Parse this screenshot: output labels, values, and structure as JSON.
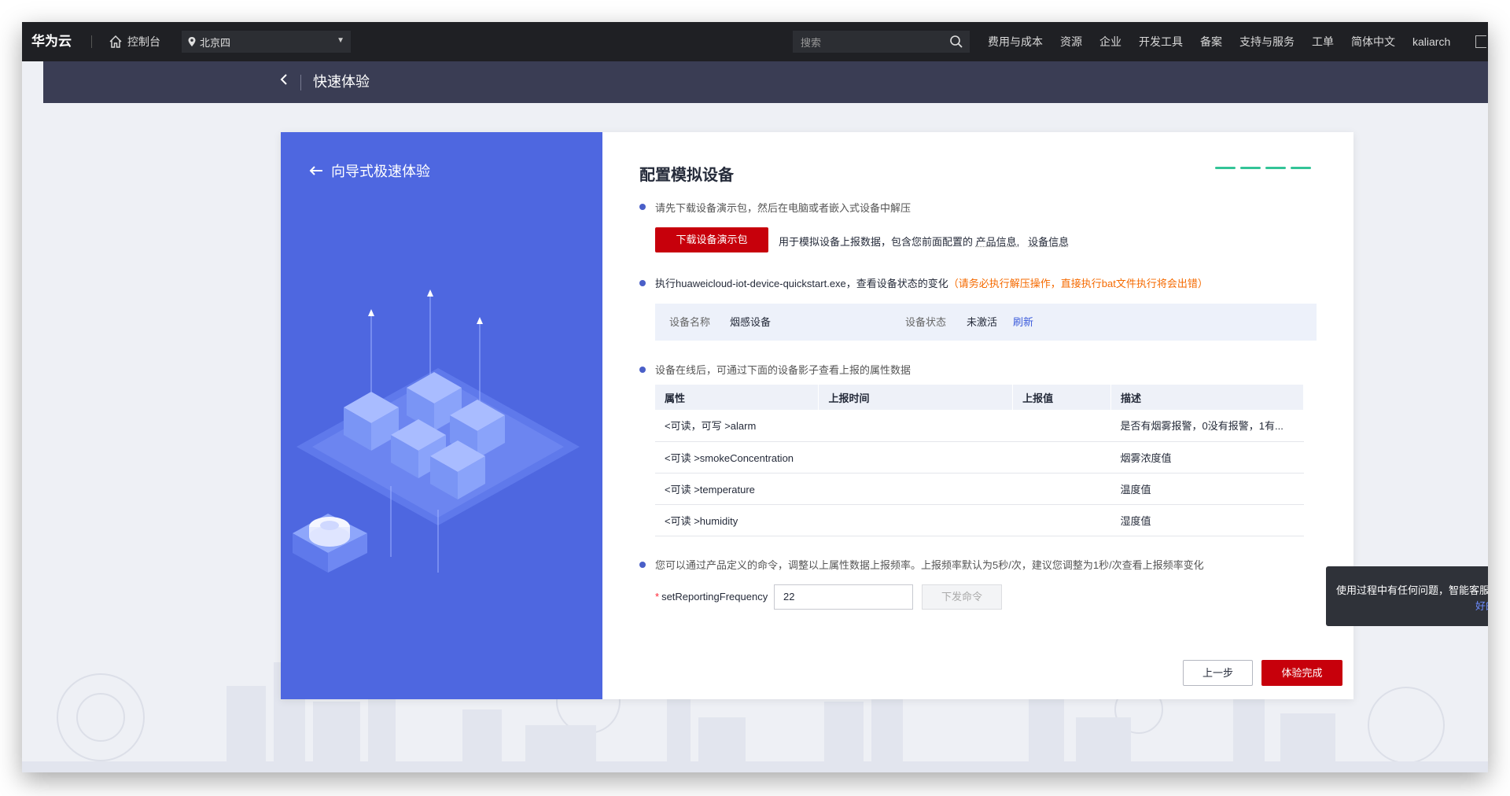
{
  "topbar": {
    "brand": "华为云",
    "console": "控制台",
    "region": "北京四",
    "search_placeholder": "搜索",
    "nav": [
      "费用与成本",
      "资源",
      "企业",
      "开发工具",
      "备案",
      "支持与服务",
      "工单",
      "简体中文",
      "kaliarch"
    ]
  },
  "subheader": {
    "title": "快速体验"
  },
  "left_panel": {
    "title": "向导式极速体验"
  },
  "main": {
    "title": "配置模拟设备",
    "step1": {
      "text": "请先下载设备演示包，然后在电脑或者嵌入式设备中解压",
      "download_button": "下载设备演示包",
      "desc_prefix": "用于模拟设备上报数据，包含您前面配置的",
      "link_product": "产品信息,",
      "link_device": "设备信息"
    },
    "step2": {
      "text": "执行huaweicloud-iot-device-quickstart.exe，查看设备状态的变化",
      "warning": "（请务必执行解压操作，直接执行bat文件执行将会出错）",
      "device_name_label": "设备名称",
      "device_name_value": "烟感设备",
      "device_status_label": "设备状态",
      "device_status_value": "未激活",
      "refresh": "刷新"
    },
    "step3": {
      "text": "设备在线后，可通过下面的设备影子查看上报的属性数据",
      "headers": [
        "属性",
        "上报时间",
        "上报值",
        "描述"
      ],
      "rows": [
        {
          "attr": "<可读，可写 >alarm",
          "time": "",
          "value": "",
          "desc": "是否有烟雾报警，0没有报警，1有..."
        },
        {
          "attr": "<可读 >smokeConcentration",
          "time": "",
          "value": "",
          "desc": "烟雾浓度值"
        },
        {
          "attr": "<可读 >temperature",
          "time": "",
          "value": "",
          "desc": "温度值"
        },
        {
          "attr": "<可读 >humidity",
          "time": "",
          "value": "",
          "desc": "湿度值"
        }
      ]
    },
    "step4": {
      "text": "您可以通过产品定义的命令，调整以上属性数据上报频率。上报频率默认为5秒/次，建议您调整为1秒/次查看上报频率变化",
      "field_label": "setReportingFrequency",
      "field_value": "22",
      "send_button": "下发命令"
    },
    "prev_button": "上一步",
    "finish_button": "体验完成"
  },
  "tooltip": {
    "text": "使用过程中有任何问题，智能客服",
    "link": "好的"
  },
  "colors": {
    "accent_red": "#c7000b",
    "panel_blue": "#4e67e0",
    "step_green": "#33c497",
    "warn_orange": "#f56a00"
  }
}
